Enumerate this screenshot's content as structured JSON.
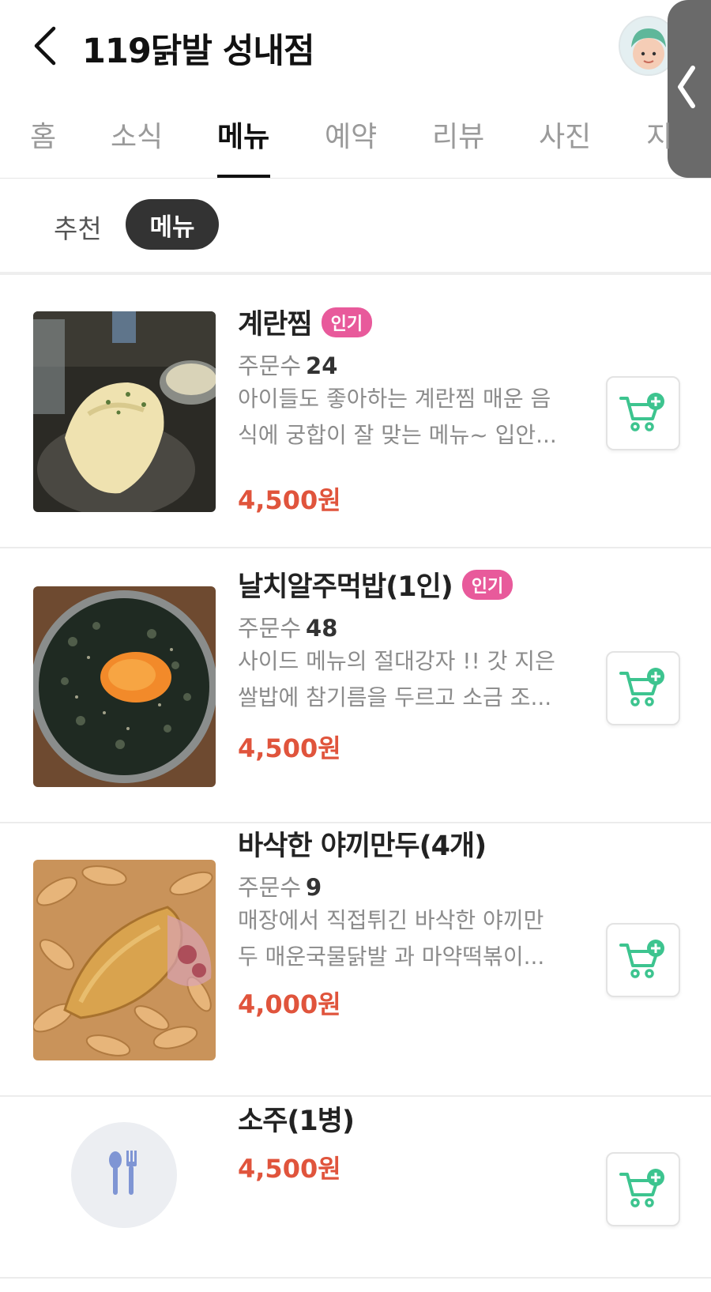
{
  "header": {
    "title": "119닭발 성내점"
  },
  "tabs": [
    "홈",
    "소식",
    "메뉴",
    "예약",
    "리뷰",
    "사진",
    "지"
  ],
  "active_tab": "메뉴",
  "subtabs": {
    "recommended": "추천",
    "menu": "메뉴"
  },
  "menu": {
    "order_label": "주문수",
    "items": [
      {
        "name": "계란찜",
        "badge": "인기",
        "orders": "24",
        "desc1": "아이들도 좋아하는 계란찜 매운 음",
        "desc2": "식에 궁합이 잘 맞는 메뉴~ 입안...",
        "price": "4,500원"
      },
      {
        "name": "날치알주먹밥(1인)",
        "badge": "인기",
        "orders": "48",
        "desc1": "사이드 메뉴의 절대강자 !! 갓 지은",
        "desc2": "쌀밥에 참기름을 두르고 소금 조...",
        "price": "4,500원"
      },
      {
        "name": "바삭한 야끼만두(4개)",
        "orders": "9",
        "desc1": "매장에서 직접튀긴 바삭한 야끼만",
        "desc2": "두 매운국물닭발 과 마약떡볶이...",
        "price": "4,000원"
      },
      {
        "name": "소주(1병)",
        "price": "4,500원"
      }
    ]
  },
  "colors": {
    "price": "#e0543c",
    "badge": "#e85a9b",
    "cart_icon": "#3dc48f"
  },
  "icons": [
    "back-arrow-icon",
    "avatar-icon",
    "chevron-left-icon",
    "cart-add-icon",
    "utensils-icon"
  ]
}
